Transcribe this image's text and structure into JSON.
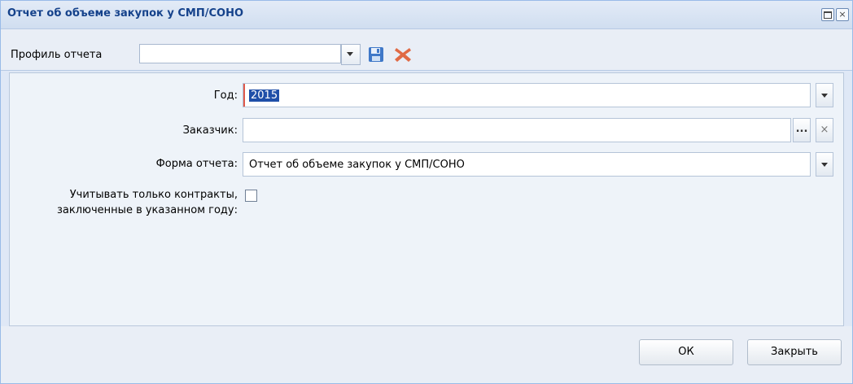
{
  "window": {
    "title": "Отчет об объеме закупок у СМП/СОНО",
    "close_glyph": "×"
  },
  "toolbar": {
    "profile_label": "Профиль отчета",
    "profile_value": ""
  },
  "form": {
    "year_label": "Год:",
    "year_value": "2015",
    "customer_label": "Заказчик:",
    "customer_value": "",
    "customer_browse_glyph": "...",
    "customer_clear_glyph": "×",
    "report_form_label": "Форма отчета:",
    "report_form_value": "Отчет об объеме закупок у СМП/СОНО",
    "contracts_label_line1": "Учитывать только контракты,",
    "contracts_label_line2": "заключенные в указанном году:",
    "contracts_checked": false
  },
  "footer": {
    "ok_label": "ОК",
    "close_label": "Закрыть"
  },
  "colors": {
    "title_text": "#15428b",
    "selection": "#1f4fa8",
    "focus_marker": "#e05a4c",
    "save_icon": "#3f78c8",
    "delete_icon": "#e06a45"
  }
}
